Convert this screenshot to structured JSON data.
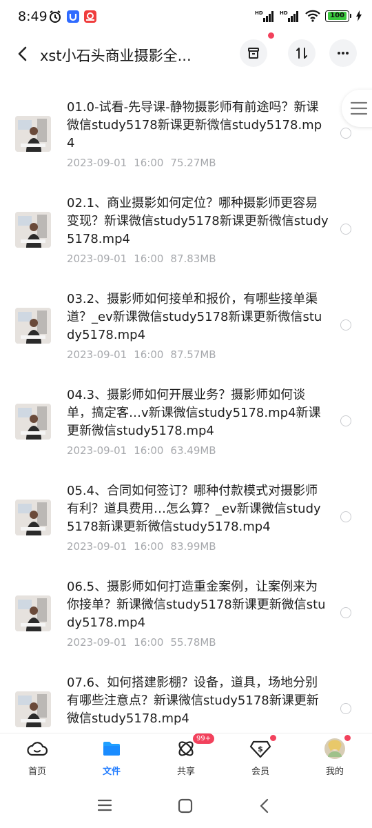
{
  "status_bar": {
    "time": "8:49",
    "network1": "HD",
    "network2": "HD",
    "battery": "100"
  },
  "header": {
    "title": "xst小石头商业摄影全..."
  },
  "files": [
    {
      "name": "01.0-试看-先导课-静物摄影师有前途吗？新课微信study5178新课更新微信study5178.mp4",
      "date": "2023-09-01",
      "time": "16:00",
      "size": "75.27MB"
    },
    {
      "name": "02.1、商业摄影如何定位？哪种摄影师更容易变现？新课微信study5178新课更新微信study5178.mp4",
      "date": "2023-09-01",
      "time": "16:00",
      "size": "87.83MB"
    },
    {
      "name": "03.2、摄影师如何接单和报价，有哪些接单渠道？_ev新课微信study5178新课更新微信study5178.mp4",
      "date": "2023-09-01",
      "time": "16:00",
      "size": "87.57MB"
    },
    {
      "name": "04.3、摄影师如何开展业务？摄影师如何谈单，搞定客…v新课微信study5178.mp4新课更新微信study5178.mp4",
      "date": "2023-09-01",
      "time": "16:00",
      "size": "63.49MB"
    },
    {
      "name": "05.4、合同如何签订？哪种付款模式对摄影师有利？道具费用…怎么算？_ev新课微信study5178新课更新微信study5178.mp4",
      "date": "2023-09-01",
      "time": "16:00",
      "size": "83.99MB"
    },
    {
      "name": "06.5、摄影师如何打造重金案例，让案例来为你接单？新课微信study5178新课更新微信study5178.mp4",
      "date": "2023-09-01",
      "time": "16:00",
      "size": "55.78MB"
    },
    {
      "name": "07.6、如何搭建影棚？设备，道具，场地分别有哪些注意点？新课微信study5178新课更新微信study5178.mp4",
      "date": "",
      "time": "",
      "size": ""
    }
  ],
  "bottom_nav": {
    "home": "首页",
    "files": "文件",
    "share": "共享",
    "share_badge": "99+",
    "member": "会员",
    "mine": "我的"
  },
  "colors": {
    "accent": "#1f7bff",
    "badge": "#f2415c",
    "meta_text": "#a7a9ad"
  }
}
